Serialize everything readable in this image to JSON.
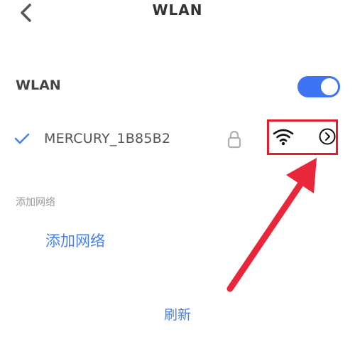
{
  "header": {
    "title": "WLAN",
    "back_icon": "chevron-left-icon"
  },
  "wlan_toggle": {
    "label": "WLAN",
    "enabled": true,
    "accent_color": "#3d74f3"
  },
  "connected_network": {
    "name": "MERCURY_1B85B2",
    "connected": true,
    "secured": true,
    "icons": [
      "check-icon",
      "lock-icon",
      "wifi-icon",
      "chevron-right-circle-icon"
    ]
  },
  "section": {
    "label": "添加网络"
  },
  "add_network": {
    "label": "添加网络"
  },
  "refresh": {
    "label": "刷新"
  },
  "annotation": {
    "color": "#e11c2c"
  }
}
